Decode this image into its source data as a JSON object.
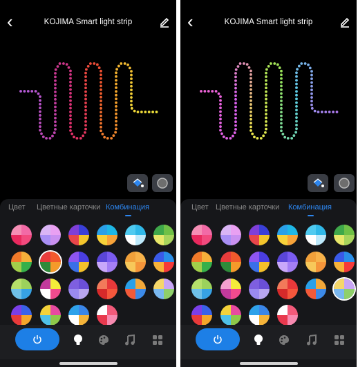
{
  "screens": [
    {
      "title": "KOJIMA  Smart light strip",
      "tabs": [
        "Цвет",
        "Цветные карточки",
        "Комбинация"
      ],
      "active_tab": 2,
      "strip_colors": [
        "#b45bd8",
        "#c23a9c",
        "#e2306a",
        "#f0522f",
        "#f3a32b",
        "#f2e63c"
      ],
      "selected_swatch": 7,
      "swatches": [
        [
          "#f26aa6",
          "#f24a7e",
          "#e8295e",
          "#f58fb5"
        ],
        [
          "#e9a0f2",
          "#c990f0",
          "#a88ff5",
          "#d9b5f5"
        ],
        [
          "#3a3fd8",
          "#f3c52c",
          "#e8464a",
          "#7e3fd8"
        ],
        [
          "#1eb7e6",
          "#f7a33a",
          "#f7d23a",
          "#2aa0e8"
        ],
        [
          "#2fb8e8",
          "#bde9fb",
          "#ffffff",
          "#4fcaf0"
        ],
        [
          "#6fc046",
          "#a8d45c",
          "#e8e86a",
          "#3fa84a"
        ],
        [
          "#f5b03a",
          "#36b04a",
          "#a2cf4a",
          "#f07a2a"
        ],
        [
          "#f25a2c",
          "#f59a2a",
          "#2f8a3a",
          "#e83c3c"
        ],
        [
          "#4a3ee0",
          "#f5c02a",
          "#3a6fe8",
          "#8e55f0"
        ],
        [
          "#7a5cf0",
          "#a57ff5",
          "#c9a8fa",
          "#5a46d8"
        ],
        [
          "#f7b24a",
          "#f5953a",
          "#f7c85a",
          "#f0a03a"
        ],
        [
          "#2a8ee8",
          "#f53a3a",
          "#f7b23a",
          "#3a5ae8"
        ],
        [
          "#9cd25c",
          "#37a2e4",
          "#6fc0e8",
          "#b6e06a"
        ],
        [
          "#f4ec3a",
          "#f04b8e",
          "#ffffff",
          "#c23a9c"
        ],
        [
          "#6a4fd8",
          "#b8a6f0",
          "#9a8af0",
          "#7e5fe0"
        ],
        [
          "#e8393a",
          "#f5573c",
          "#d62a2a",
          "#f27a5a"
        ],
        [
          "#f2a83a",
          "#3c8ae8",
          "#f25a3a",
          "#2aa0e8"
        ],
        [
          "#c8a6f5",
          "#8fd06a",
          "#7ab8f0",
          "#f5d76a"
        ],
        [
          "#3a62e8",
          "#f5a52a",
          "#e83a3a",
          "#7b3fe8"
        ],
        [
          "#e84aa0",
          "#8ec84a",
          "#4fc0e8",
          "#f4d23a"
        ],
        [
          "#3a86e8",
          "#f5b43a",
          "#ffffff",
          "#2fa2ea"
        ],
        [
          "#f25a7a",
          "#f78ab0",
          "#e8394e",
          "#ffffff"
        ]
      ],
      "nav_icons": [
        "power-icon",
        "bulb-icon",
        "palette-icon",
        "music-icon",
        "grid-icon"
      ]
    },
    {
      "title": "KOJIMA  Smart light strip",
      "tabs": [
        "Цвет",
        "Цветные карточки",
        "Комбинация"
      ],
      "active_tab": 2,
      "strip_colors": [
        "#f064d8",
        "#d860f0",
        "#f0e84c",
        "#96e35a",
        "#5ccfe6",
        "#b07af0"
      ],
      "selected_swatch": 17,
      "swatches": [
        [
          "#f26aa6",
          "#f24a7e",
          "#e8295e",
          "#f58fb5"
        ],
        [
          "#e9a0f2",
          "#c990f0",
          "#a88ff5",
          "#d9b5f5"
        ],
        [
          "#3a3fd8",
          "#f3c52c",
          "#e8464a",
          "#7e3fd8"
        ],
        [
          "#1eb7e6",
          "#f7a33a",
          "#f7d23a",
          "#2aa0e8"
        ],
        [
          "#2fb8e8",
          "#bde9fb",
          "#ffffff",
          "#4fcaf0"
        ],
        [
          "#6fc046",
          "#a8d45c",
          "#e8e86a",
          "#3fa84a"
        ],
        [
          "#f5b03a",
          "#36b04a",
          "#a2cf4a",
          "#f07a2a"
        ],
        [
          "#f25a2c",
          "#f59a2a",
          "#2f8a3a",
          "#e83c3c"
        ],
        [
          "#4a3ee0",
          "#f5c02a",
          "#3a6fe8",
          "#8e55f0"
        ],
        [
          "#7a5cf0",
          "#a57ff5",
          "#c9a8fa",
          "#5a46d8"
        ],
        [
          "#f7b24a",
          "#f5953a",
          "#f7c85a",
          "#f0a03a"
        ],
        [
          "#2a8ee8",
          "#f53a3a",
          "#f7b23a",
          "#3a5ae8"
        ],
        [
          "#9cd25c",
          "#37a2e4",
          "#6fc0e8",
          "#b6e06a"
        ],
        [
          "#f4ec3a",
          "#f04b8e",
          "#c23a9c",
          "#f5a0d0"
        ],
        [
          "#6a4fd8",
          "#b8a6f0",
          "#9a8af0",
          "#7e5fe0"
        ],
        [
          "#e8393a",
          "#f5573c",
          "#d62a2a",
          "#f27a5a"
        ],
        [
          "#f2a83a",
          "#3c8ae8",
          "#f25a3a",
          "#2aa0e8"
        ],
        [
          "#c8a6f5",
          "#8fd06a",
          "#7ab8f0",
          "#f5d76a"
        ],
        [
          "#3a62e8",
          "#f5a52a",
          "#e83a3a",
          "#7b3fe8"
        ],
        [
          "#e84aa0",
          "#8ec84a",
          "#4fc0e8",
          "#f4d23a"
        ],
        [
          "#3a86e8",
          "#f5b43a",
          "#ffffff",
          "#2fa2ea"
        ],
        [
          "#f25a7a",
          "#f78ab0",
          "#e8394e",
          "#ffffff"
        ]
      ],
      "nav_icons": [
        "power-icon",
        "bulb-icon",
        "palette-icon",
        "music-icon",
        "grid-icon"
      ]
    }
  ],
  "colors": {
    "accent": "#2d86ef",
    "background": "#000000",
    "panel": "#16171a",
    "tab_inactive": "#8a8a8a"
  }
}
